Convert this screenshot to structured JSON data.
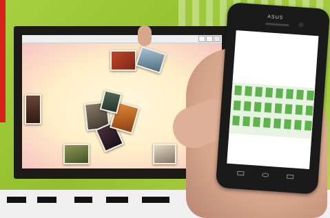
{
  "monitor_window": {
    "title": ""
  },
  "phone": {
    "brand": "ASUS"
  },
  "photos": [
    {
      "name": "photo-flowers-top",
      "color": "#c0452a"
    },
    {
      "name": "photo-sky-top",
      "color": "#6c8aa0"
    },
    {
      "name": "photo-wood-left",
      "color": "#4b2e25"
    },
    {
      "name": "photo-cluster-a",
      "color": "#5f5248"
    },
    {
      "name": "photo-cluster-b",
      "color": "#2b1e24"
    },
    {
      "name": "photo-cluster-c",
      "color": "#c96a23"
    },
    {
      "name": "photo-garden-bottom",
      "color": "#6f7f3e"
    },
    {
      "name": "photo-white-flowers",
      "color": "#c9c0aa"
    }
  ],
  "colors": {
    "background": "#9bc33a",
    "accent_red": "#d8211b",
    "phone_tiles": "#5eb34d"
  }
}
